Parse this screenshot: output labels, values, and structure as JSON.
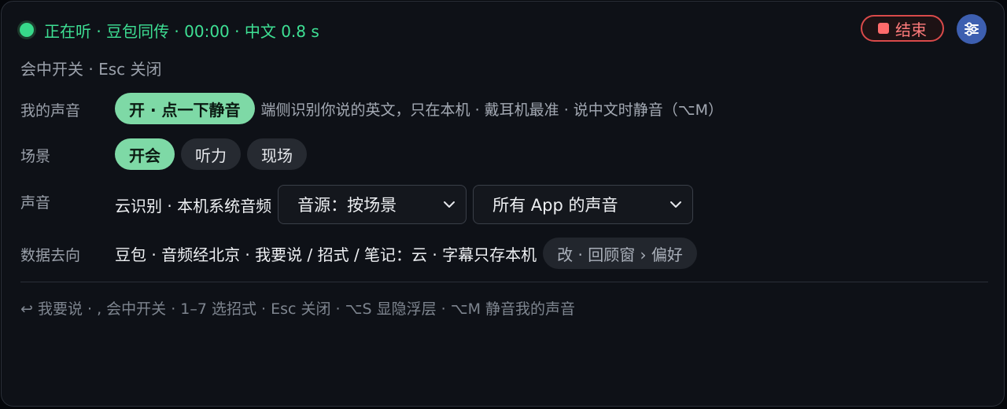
{
  "header": {
    "status": "正在听 · 豆包同传 · 00:00 · 中文 0.8 s",
    "end_label": "结束",
    "status_color": "#3ee094"
  },
  "subtitle": "会中开关 · Esc 关闭",
  "rows": {
    "my_voice": {
      "label": "我的声音",
      "toggle": "开 · 点一下静音",
      "note": "端侧识别你说的英文，只在本机 · 戴耳机最准 · 说中文时静音（⌥M）"
    },
    "scene": {
      "label": "场景",
      "options": [
        "开会",
        "听力",
        "现场"
      ],
      "selected": "开会"
    },
    "audio": {
      "label": "声音",
      "info": "云识别 · 本机系统音频",
      "source_select": "音源：按场景",
      "app_select": "所有 App 的声音"
    },
    "data": {
      "label": "数据去向",
      "info": "豆包 · 音频经北京 · 我要说 / 招式 / 笔记：云 · 字幕只存本机",
      "action": "改 · 回顾窗 › 偏好"
    }
  },
  "hint": "↩ 我要说 · , 会中开关 · 1–7 选招式 · Esc 关闭 · ⌥S 显隐浮层 · ⌥M 静音我的声音",
  "icons": {
    "status": "live-dot-icon",
    "end": "stop-square-icon",
    "settings": "sliders-icon",
    "select": "chevron-down-icon"
  }
}
